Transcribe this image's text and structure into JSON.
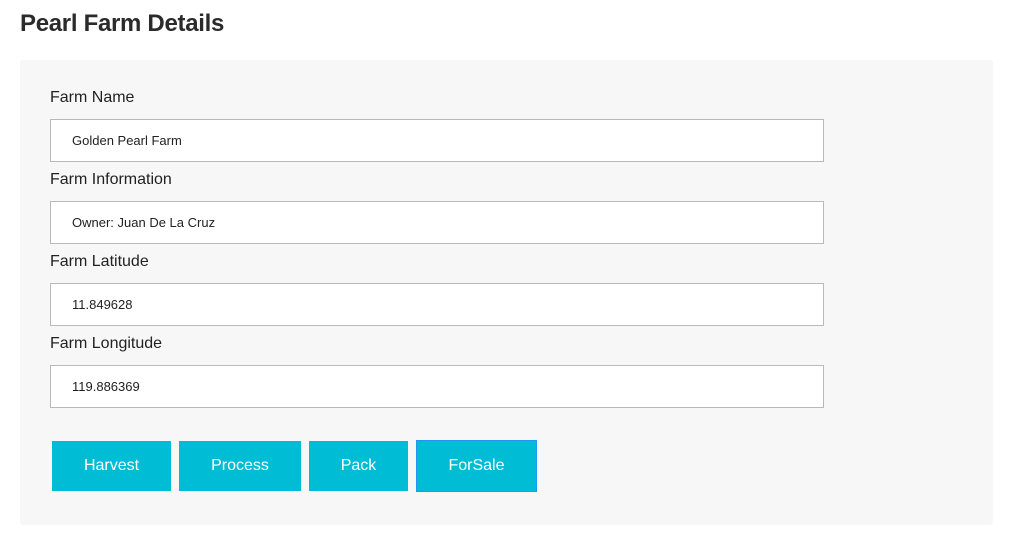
{
  "page": {
    "title": "Pearl Farm Details"
  },
  "form": {
    "fields": [
      {
        "label": "Farm Name",
        "value": "Golden Pearl Farm"
      },
      {
        "label": "Farm Information",
        "value": "Owner: Juan De La Cruz"
      },
      {
        "label": "Farm Latitude",
        "value": "11.849628"
      },
      {
        "label": "Farm Longitude",
        "value": "119.886369"
      }
    ]
  },
  "actions": {
    "harvest": "Harvest",
    "process": "Process",
    "pack": "Pack",
    "forsale": "ForSale"
  },
  "colors": {
    "button_background": "#00bcd4",
    "button_text": "#ffffff",
    "focused_button_border": "#2196f3",
    "panel_background": "#f7f7f7"
  }
}
